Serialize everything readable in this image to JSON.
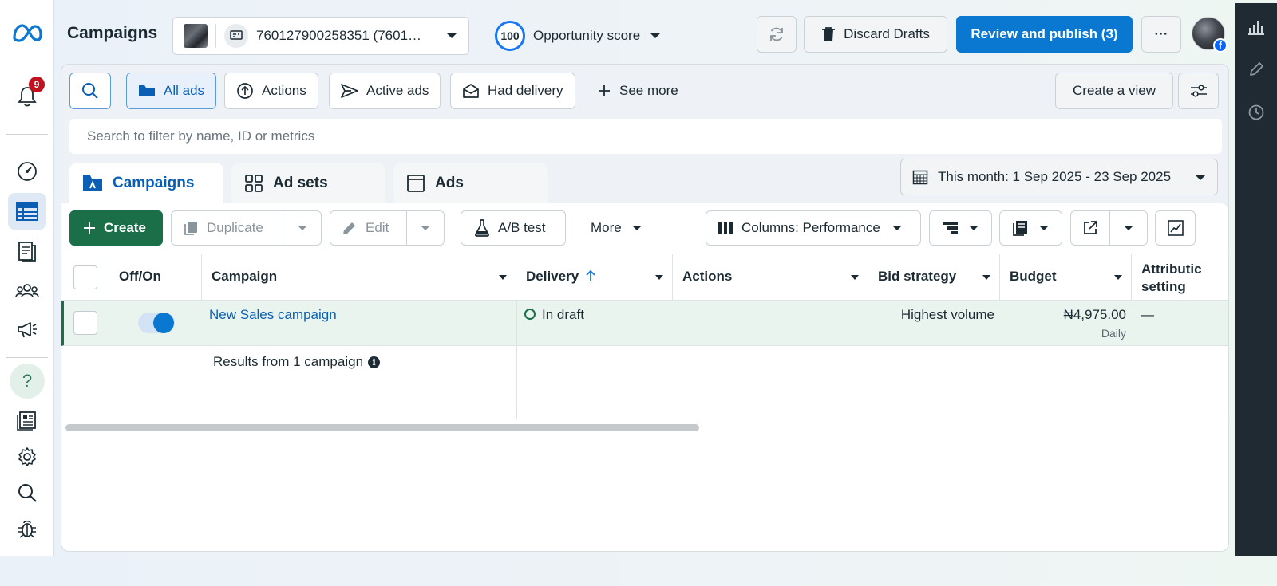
{
  "header": {
    "title": "Campaigns",
    "account_id": "760127900258351 (7601…",
    "opportunity_score": "100",
    "opportunity_label": "Opportunity score",
    "discard_label": "Discard Drafts",
    "publish_label": "Review and publish (3)",
    "more_glyph": "···"
  },
  "notifications": {
    "count": "9"
  },
  "filters": {
    "all_ads": "All ads",
    "actions": "Actions",
    "active_ads": "Active ads",
    "had_delivery": "Had delivery",
    "see_more": "See more",
    "create_view": "Create a view",
    "search_placeholder": "Search to filter by name, ID or metrics"
  },
  "tabs": [
    {
      "label": "Campaigns"
    },
    {
      "label": "Ad sets"
    },
    {
      "label": "Ads"
    }
  ],
  "date_range": "This month: 1 Sep 2025 - 23 Sep 2025",
  "toolbar": {
    "create": "Create",
    "duplicate": "Duplicate",
    "edit": "Edit",
    "ab_test": "A/B test",
    "more": "More",
    "columns": "Columns: Performance"
  },
  "table": {
    "headers": {
      "off_on": "Off/On",
      "campaign": "Campaign",
      "delivery": "Delivery",
      "actions": "Actions",
      "bid_strategy": "Bid strategy",
      "budget": "Budget",
      "attribution_1": "Attributic",
      "attribution_2": "setting"
    },
    "rows": [
      {
        "campaign": "New Sales campaign",
        "delivery": "In draft",
        "bid_strategy": "Highest volume",
        "budget": "₦4,975.00",
        "budget_period": "Daily",
        "attribution": "—",
        "enabled": true
      }
    ],
    "summary": "Results from 1 campaign"
  },
  "colors": {
    "primary": "#0a78d1",
    "create_green": "#1a6f48",
    "active_nav": "#0a5fb4",
    "badge_red": "#c1121f"
  }
}
